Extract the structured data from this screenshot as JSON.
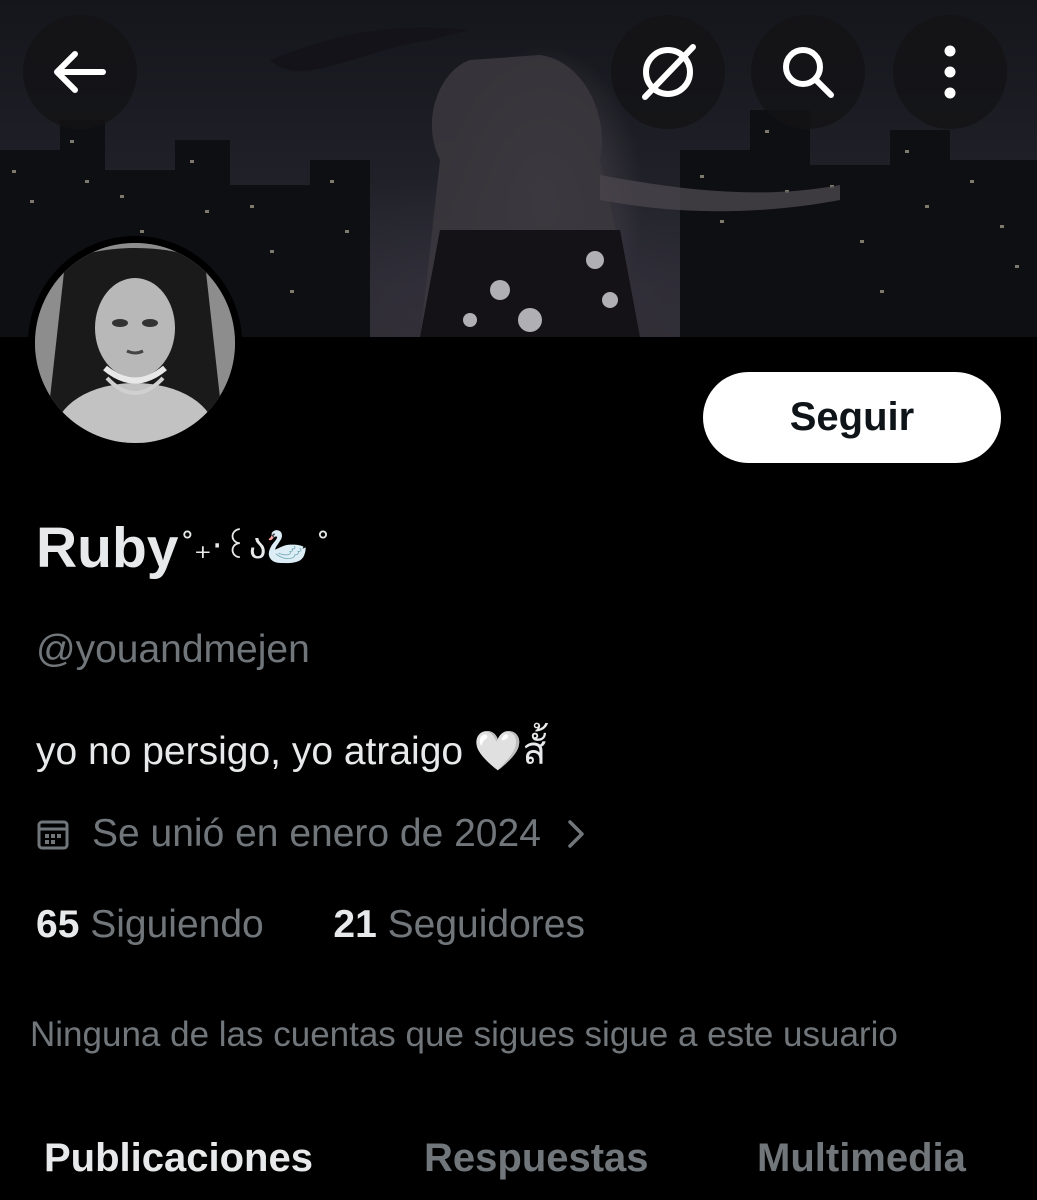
{
  "header": {
    "back_icon": "arrow-left-icon",
    "grok_icon": "grok-slash-circle-icon",
    "search_icon": "search-icon",
    "more_icon": "more-vertical-icon"
  },
  "profile": {
    "follow_label": "Seguir",
    "name": "Ruby",
    "name_decoration": "˚₊‧꒰ა🦢 ˚",
    "handle": "@youandmejen",
    "bio": "yo no persigo, yo atraigo 🤍สั้",
    "joined": "Se unió en enero de 2024",
    "following_count": "65",
    "following_label": "Siguiendo",
    "followers_count": "21",
    "followers_label": "Seguidores",
    "mutual_text": "Ninguna de las cuentas que sigues sigue a este usuario"
  },
  "tabs": [
    {
      "label": "Publicaciones",
      "active": true
    },
    {
      "label": "Respuestas",
      "active": false
    },
    {
      "label": "Multimedia",
      "active": false
    }
  ],
  "colors": {
    "background": "#000000",
    "primary_text": "#e7e9ea",
    "secondary_text": "#71767b",
    "button_bg": "#ffffff"
  }
}
